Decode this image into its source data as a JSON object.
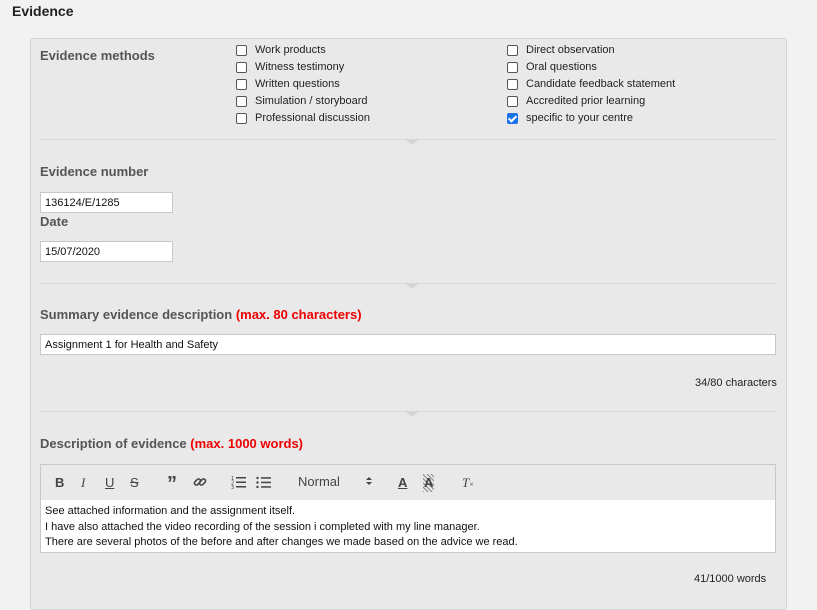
{
  "page_title": "Evidence",
  "evidence_methods": {
    "label": "Evidence methods",
    "left_column": [
      {
        "label": "Work products",
        "checked": false
      },
      {
        "label": "Witness testimony",
        "checked": false
      },
      {
        "label": "Written questions",
        "checked": false
      },
      {
        "label": "Simulation / storyboard",
        "checked": false
      },
      {
        "label": "Professional discussion",
        "checked": false
      }
    ],
    "right_column": [
      {
        "label": "Direct observation",
        "checked": false
      },
      {
        "label": "Oral questions",
        "checked": false
      },
      {
        "label": "Candidate feedback statement",
        "checked": false
      },
      {
        "label": "Accredited prior learning",
        "checked": false
      },
      {
        "label": "specific to your centre",
        "checked": true
      }
    ]
  },
  "evidence_number": {
    "label": "Evidence number",
    "value": "136124/E/1285"
  },
  "date": {
    "label": "Date",
    "value": "15/07/2020"
  },
  "summary": {
    "label": "Summary evidence description",
    "limit_note": "(max. 80 characters)",
    "value": "Assignment 1 for Health and Safety",
    "counter": "34/80 characters"
  },
  "description": {
    "label": "Description of evidence",
    "limit_note": "(max. 1000 words)",
    "toolbar": {
      "bold": "B",
      "italic": "I",
      "underline": "U",
      "strike": "S",
      "quote": "”",
      "link_icon": "link-icon",
      "ordered_list_icon": "ordered-list-icon",
      "bullet_list_icon": "bullet-list-icon",
      "heading_select": "Normal",
      "text_color": "A",
      "highlight": "A",
      "clear_format": "T"
    },
    "lines": [
      "See attached information and the assignment itself.",
      "I have also attached the video recording of the session i completed with my line manager.",
      "There are several photos of the before and after changes we made based on the advice we read."
    ],
    "counter": "41/1000 words"
  },
  "colors": {
    "required_note": "#ee0000",
    "checked": "#1a73e8",
    "panel": "#e9e9ea"
  }
}
